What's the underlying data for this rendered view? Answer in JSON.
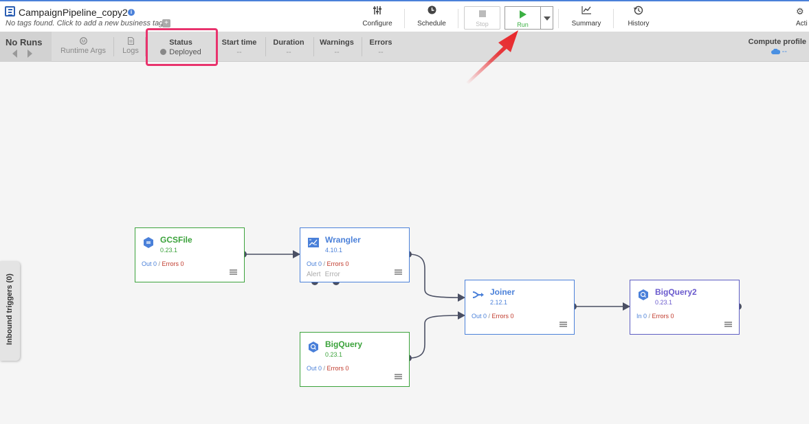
{
  "header": {
    "title": "CampaignPipeline_copy2",
    "info_icon": "info-icon",
    "tags_text": "No tags found. Click to add a new business tag.",
    "tag_add_label": "+",
    "toolbar": {
      "configure": "Configure",
      "schedule": "Schedule",
      "stop": "Stop",
      "run": "Run",
      "summary": "Summary",
      "history": "History",
      "actions": "Acti"
    }
  },
  "run_bar": {
    "no_runs": "No Runs",
    "runtime_args": "Runtime Args",
    "logs": "Logs",
    "status_label": "Status",
    "status_value": "Deployed",
    "start_time_label": "Start time",
    "start_time_value": "--",
    "duration_label": "Duration",
    "duration_value": "--",
    "warnings_label": "Warnings",
    "warnings_value": "--",
    "errors_label": "Errors",
    "errors_value": "--",
    "compute_label": "Compute profile",
    "compute_value": "--"
  },
  "inbound_triggers": "Inbound triggers (0)",
  "nodes": [
    {
      "name": "GCSFile",
      "version": "0.23.1",
      "kind": "source",
      "stat_label": "Out 0",
      "errors": "Errors 0"
    },
    {
      "name": "Wrangler",
      "version": "4.10.1",
      "kind": "transform",
      "stat_label": "Out 0",
      "errors": "Errors 0",
      "ports": [
        "Alert",
        "Error"
      ]
    },
    {
      "name": "BigQuery",
      "version": "0.23.1",
      "kind": "source",
      "stat_label": "Out 0",
      "errors": "Errors 0"
    },
    {
      "name": "Joiner",
      "version": "2.12.1",
      "kind": "transform",
      "stat_label": "Out 0",
      "errors": "Errors 0"
    },
    {
      "name": "BigQuery2",
      "version": "0.23.1",
      "kind": "sink",
      "stat_label": "In 0",
      "errors": "Errors 0"
    }
  ],
  "colors": {
    "accent": "#4a80d9",
    "source": "#3aa23a",
    "sink": "#6a5acd",
    "highlight": "#e8336d",
    "annotation_arrow": "#e8262a"
  }
}
